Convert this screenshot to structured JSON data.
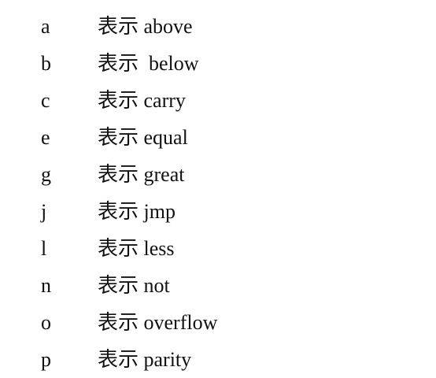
{
  "items": [
    {
      "letter": "a",
      "text": "表示 above"
    },
    {
      "letter": "b",
      "text": "表示  below"
    },
    {
      "letter": "c",
      "text": "表示 carry"
    },
    {
      "letter": "e",
      "text": "表示 equal"
    },
    {
      "letter": "g",
      "text": "表示 great"
    },
    {
      "letter": "j",
      "text": "表示 jmp"
    },
    {
      "letter": "l",
      "text": "表示 less"
    },
    {
      "letter": "n",
      "text": "表示 not"
    },
    {
      "letter": "o",
      "text": "表示 overflow"
    },
    {
      "letter": "p",
      "text": "表示 parity"
    }
  ]
}
